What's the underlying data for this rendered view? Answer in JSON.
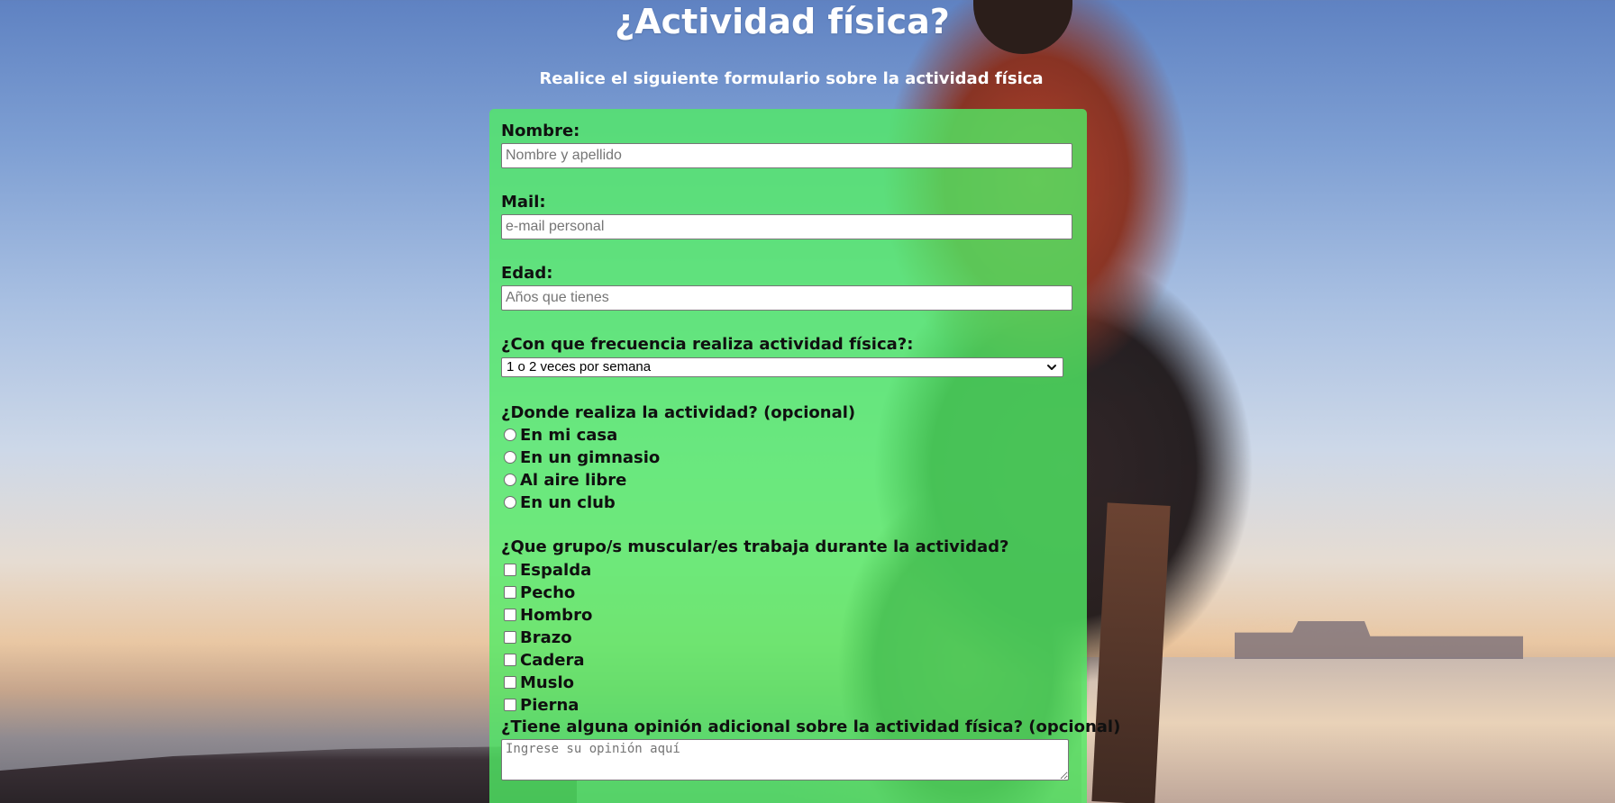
{
  "header": {
    "title": "¿Actividad física?",
    "subtitle": "Realice el siguiente formulario sobre la actividad física"
  },
  "form": {
    "nombre": {
      "label": "Nombre:",
      "placeholder": "Nombre y apellido",
      "value": ""
    },
    "mail": {
      "label": "Mail:",
      "placeholder": "e-mail personal",
      "value": ""
    },
    "edad": {
      "label": "Edad:",
      "placeholder": "Años que tienes",
      "value": ""
    },
    "frecuencia": {
      "label": "¿Con que frecuencia realiza actividad física?:",
      "selected": "1 o 2 veces por semana"
    },
    "lugar": {
      "label": "¿Donde realiza la actividad? (opcional)",
      "options": [
        "En mi casa",
        "En un gimnasio",
        "Al aire libre",
        "En un club"
      ]
    },
    "musculos": {
      "label": "¿Que grupo/s muscular/es trabaja durante la actividad?",
      "options": [
        "Espalda",
        "Pecho",
        "Hombro",
        "Brazo",
        "Cadera",
        "Muslo",
        "Pierna"
      ]
    },
    "opinion": {
      "label": "¿Tiene alguna opinión adicional sobre la actividad física? (opcional)",
      "placeholder": "Ingrese su opinión aquí"
    }
  },
  "colors": {
    "panel": "#50EB64",
    "title_text": "#ffffff",
    "label_text": "#101010"
  },
  "icons": {
    "select_arrow": "chevron-down-icon"
  }
}
